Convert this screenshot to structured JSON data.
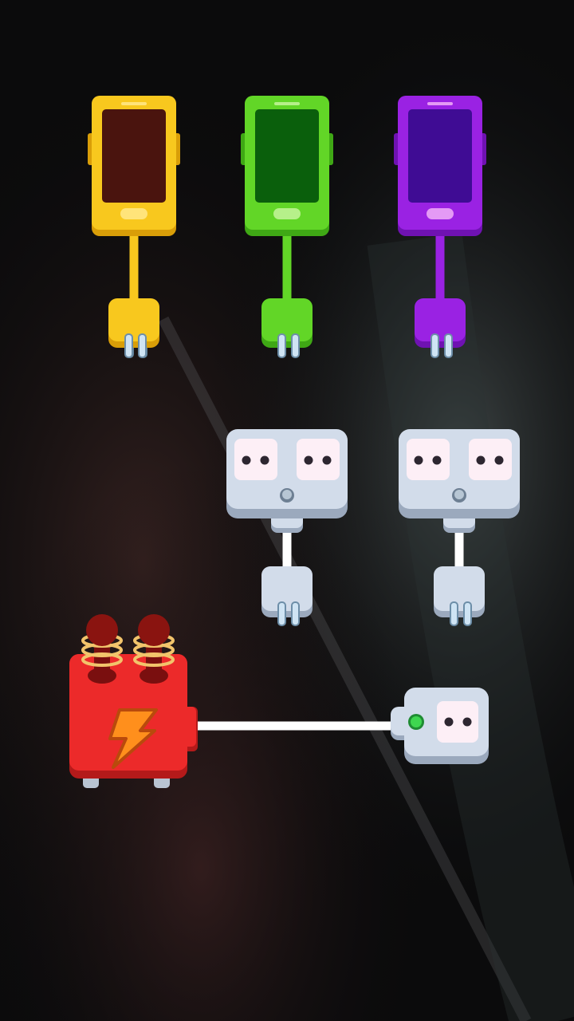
{
  "game": {
    "phones": [
      {
        "id": "yellow",
        "body": "#f8c81e",
        "edge": "#d99e08",
        "screen": "#4a140e",
        "button": "#ffe47a"
      },
      {
        "id": "green",
        "body": "#62d627",
        "edge": "#3fa815",
        "screen": "#0a5f0c",
        "button": "#b6f08a"
      },
      {
        "id": "purple",
        "body": "#9a22e3",
        "edge": "#6f12b2",
        "screen": "#3f0c94",
        "button": "#e49af5"
      }
    ],
    "double_sockets": [
      {
        "id": "socket-left"
      },
      {
        "id": "socket-right"
      }
    ],
    "single_socket": {
      "id": "socket-powered",
      "indicator": "#3fd650"
    },
    "power_source": {
      "id": "battery",
      "body": "#ec2a2a",
      "bolt": "#ff8f1c",
      "coil": "#f2c46b"
    },
    "colors": {
      "socket": "#d2dcea",
      "socket_edge": "#9ba9bd",
      "socket_face": "#fdeff6",
      "prong": "#8fb7d8",
      "wire_white": "#ffffff"
    }
  }
}
